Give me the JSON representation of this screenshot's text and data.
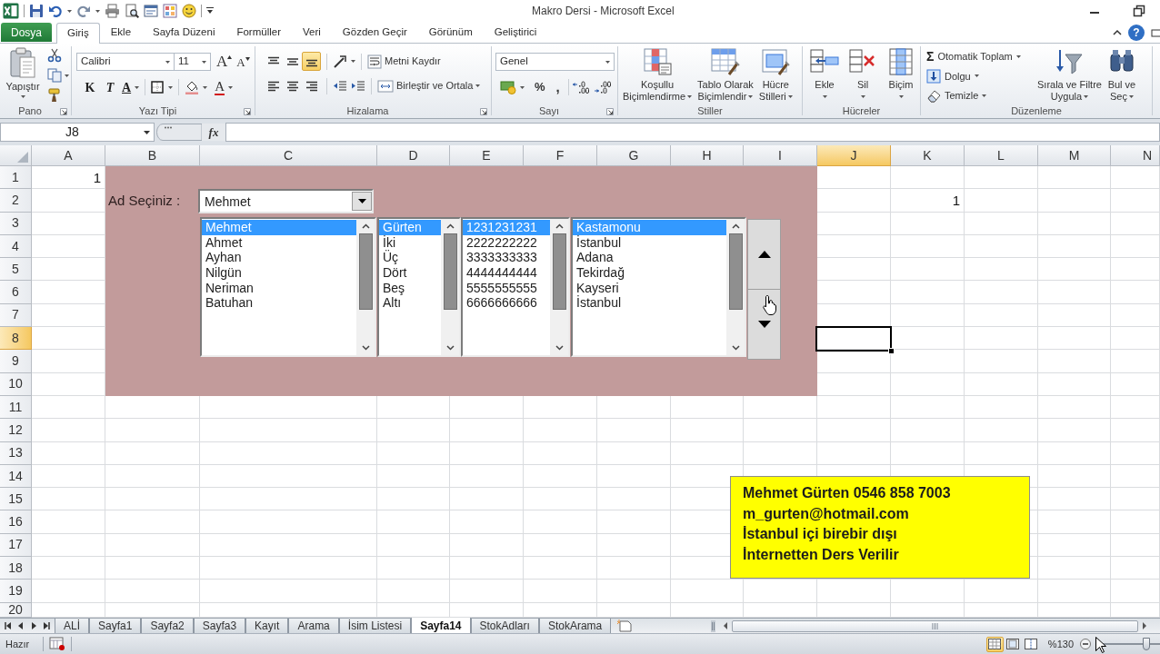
{
  "window": {
    "title": "Makro Dersi - Microsoft Excel",
    "help": "?"
  },
  "ribbon_tabs": [
    {
      "label": "Dosya",
      "kind": "file",
      "selected": false
    },
    {
      "label": "Giriş",
      "kind": "tab",
      "selected": true
    },
    {
      "label": "Ekle",
      "kind": "tab",
      "selected": false
    },
    {
      "label": "Sayfa Düzeni",
      "kind": "tab",
      "selected": false
    },
    {
      "label": "Formüller",
      "kind": "tab",
      "selected": false
    },
    {
      "label": "Veri",
      "kind": "tab",
      "selected": false
    },
    {
      "label": "Gözden Geçir",
      "kind": "tab",
      "selected": false
    },
    {
      "label": "Görünüm",
      "kind": "tab",
      "selected": false
    },
    {
      "label": "Geliştirici",
      "kind": "tab",
      "selected": false
    }
  ],
  "ribbon": {
    "clipboard": {
      "label": "Pano",
      "paste": "Yapıştır"
    },
    "font": {
      "label": "Yazı Tipi",
      "font_name": "Calibri",
      "font_size": "11",
      "grow": "A",
      "shrink": "A",
      "bold": "K",
      "italic": "T",
      "underline": "A",
      "font_color": "A"
    },
    "alignment": {
      "label": "Hizalama",
      "vertical": [
        {
          "kind": "top",
          "selected": false
        },
        {
          "kind": "middle",
          "selected": false
        },
        {
          "kind": "bottom",
          "selected": true
        }
      ],
      "horizontal": [
        {
          "kind": "left",
          "selected": false
        },
        {
          "kind": "center",
          "selected": false
        },
        {
          "kind": "right",
          "selected": false
        }
      ],
      "wrap_text": "Metni Kaydır",
      "merge": "Birleştir ve Ortala"
    },
    "number": {
      "label": "Sayı",
      "format": "Genel",
      "percent": "%",
      "comma": ","
    },
    "styles": {
      "label": "Stiller",
      "buttons": [
        {
          "kind": "conditional",
          "lines": [
            "Koşullu",
            "Biçimlendirme"
          ]
        },
        {
          "kind": "table",
          "lines": [
            "Tablo Olarak",
            "Biçimlendir"
          ]
        },
        {
          "kind": "cell",
          "lines": [
            "Hücre",
            "Stilleri"
          ]
        }
      ]
    },
    "cells": {
      "label": "Hücreler",
      "buttons": [
        {
          "kind": "insert",
          "label": "Ekle"
        },
        {
          "kind": "delete",
          "label": "Sil"
        },
        {
          "kind": "format",
          "label": "Biçim"
        }
      ]
    },
    "editing": {
      "label": "Düzenleme",
      "autosum_symbol": "Σ",
      "autosum": "Otomatik Toplam",
      "fill": "Dolgu",
      "clear": "Temizle",
      "sort": [
        "Sırala ve Filtre",
        "Uygula"
      ],
      "find": [
        "Bul ve",
        "Seç"
      ]
    }
  },
  "formula_bar": {
    "name_box": "J8",
    "function_button": "fx"
  },
  "sheet": {
    "columns": [
      {
        "label": "A",
        "selected": false
      },
      {
        "label": "B",
        "selected": false
      },
      {
        "label": "C",
        "selected": false
      },
      {
        "label": "D",
        "selected": false
      },
      {
        "label": "E",
        "selected": false
      },
      {
        "label": "F",
        "selected": false
      },
      {
        "label": "G",
        "selected": false
      },
      {
        "label": "H",
        "selected": false
      },
      {
        "label": "I",
        "selected": false
      },
      {
        "label": "J",
        "selected": true
      },
      {
        "label": "K",
        "selected": false
      },
      {
        "label": "L",
        "selected": false
      },
      {
        "label": "M",
        "selected": false
      },
      {
        "label": "N",
        "selected": false
      }
    ],
    "rows": [
      {
        "label": "1",
        "selected": false
      },
      {
        "label": "2",
        "selected": false
      },
      {
        "label": "3",
        "selected": false
      },
      {
        "label": "4",
        "selected": false
      },
      {
        "label": "5",
        "selected": false
      },
      {
        "label": "6",
        "selected": false
      },
      {
        "label": "7",
        "selected": false
      },
      {
        "label": "8",
        "selected": true
      },
      {
        "label": "9",
        "selected": false
      },
      {
        "label": "10",
        "selected": false
      },
      {
        "label": "11",
        "selected": false
      },
      {
        "label": "12",
        "selected": false
      },
      {
        "label": "13",
        "selected": false
      },
      {
        "label": "14",
        "selected": false
      },
      {
        "label": "15",
        "selected": false
      },
      {
        "label": "16",
        "selected": false
      },
      {
        "label": "17",
        "selected": false
      },
      {
        "label": "18",
        "selected": false
      },
      {
        "label": "19",
        "selected": false
      },
      {
        "label": "20",
        "selected": false
      }
    ],
    "cells": [
      {
        "value": "1"
      },
      {
        "value": "1"
      }
    ]
  },
  "form": {
    "label": "Ad Seçiniz :",
    "combo_value": "Mehmet",
    "lists": [
      {
        "items": [
          {
            "text": "Mehmet",
            "selected": true
          },
          {
            "text": "Ahmet",
            "selected": false
          },
          {
            "text": "Ayhan",
            "selected": false
          },
          {
            "text": "Nilgün",
            "selected": false
          },
          {
            "text": "Neriman",
            "selected": false
          },
          {
            "text": "Batuhan",
            "selected": false
          }
        ]
      },
      {
        "items": [
          {
            "text": "Gürten",
            "selected": true
          },
          {
            "text": "İki",
            "selected": false
          },
          {
            "text": "Üç",
            "selected": false
          },
          {
            "text": "Dört",
            "selected": false
          },
          {
            "text": "Beş",
            "selected": false
          },
          {
            "text": "Altı",
            "selected": false
          }
        ]
      },
      {
        "items": [
          {
            "text": "1231231231",
            "selected": true
          },
          {
            "text": "2222222222",
            "selected": false
          },
          {
            "text": "3333333333",
            "selected": false
          },
          {
            "text": "4444444444",
            "selected": false
          },
          {
            "text": "5555555555",
            "selected": false
          },
          {
            "text": "6666666666",
            "selected": false
          }
        ]
      },
      {
        "items": [
          {
            "text": "Kastamonu",
            "selected": true
          },
          {
            "text": "İstanbul",
            "selected": false
          },
          {
            "text": "Adana",
            "selected": false
          },
          {
            "text": "Tekirdağ",
            "selected": false
          },
          {
            "text": "Kayseri",
            "selected": false
          },
          {
            "text": "İstanbul",
            "selected": false
          }
        ]
      }
    ]
  },
  "text_box": {
    "lines": [
      "Mehmet Gürten 0546 858 7003",
      "m_gurten@hotmail.com",
      "İstanbul içi birebir dışı",
      "İnternetten Ders Verilir"
    ]
  },
  "sheet_tabs": [
    {
      "label": "ALİ",
      "selected": false
    },
    {
      "label": "Sayfa1",
      "selected": false
    },
    {
      "label": "Sayfa2",
      "selected": false
    },
    {
      "label": "Sayfa3",
      "selected": false
    },
    {
      "label": "Kayıt",
      "selected": false
    },
    {
      "label": "Arama",
      "selected": false
    },
    {
      "label": "İsim Listesi",
      "selected": false
    },
    {
      "label": "Sayfa14",
      "selected": true
    },
    {
      "label": "StokAdları",
      "selected": false
    },
    {
      "label": "StokArama",
      "selected": false
    }
  ],
  "status_bar": {
    "mode": "Hazır",
    "zoom": "%130",
    "views": [
      {
        "kind": "normal",
        "selected": true
      },
      {
        "kind": "page_layout",
        "selected": false
      },
      {
        "kind": "page_break",
        "selected": false
      }
    ],
    "zoom_slider": {
      "level": 0.77
    }
  }
}
